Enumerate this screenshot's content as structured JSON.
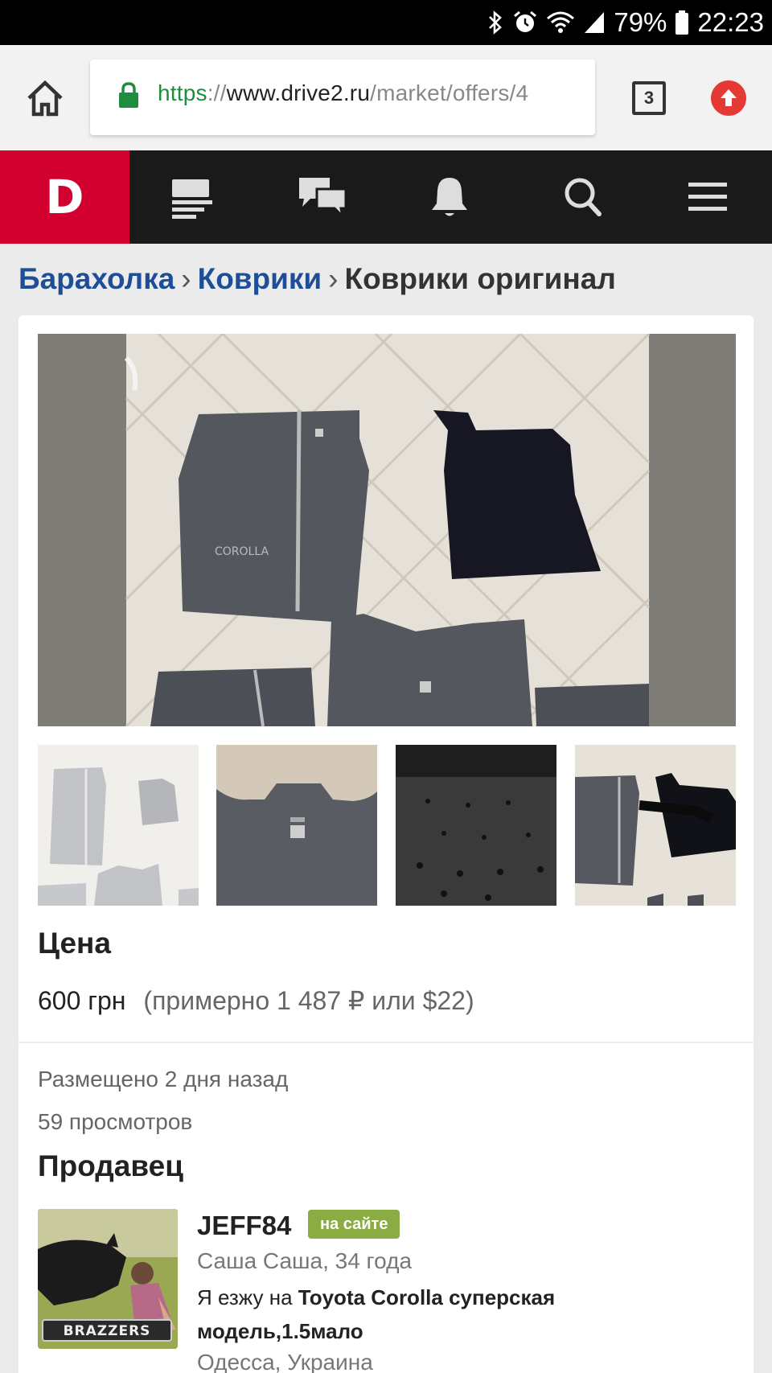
{
  "status_bar": {
    "battery": "79%",
    "time": "22:23",
    "icons": [
      "bluetooth-icon",
      "alarm-icon",
      "wifi-icon",
      "signal-icon",
      "battery-icon"
    ]
  },
  "browser": {
    "url_scheme": "https",
    "url_sep": "://",
    "url_host": "www.drive2.ru",
    "url_path": "/market/offers/4",
    "tabs_count": "3"
  },
  "site_nav": {
    "logo": "D",
    "items": [
      "feed-icon",
      "messages-icon",
      "notifications-icon",
      "search-icon",
      "menu-icon"
    ]
  },
  "breadcrumb": {
    "items": [
      "Барахолка",
      "Коврики"
    ],
    "separator": "›",
    "current": "Коврики оригинал"
  },
  "listing": {
    "price_title": "Цена",
    "price": "600 грн",
    "price_approx": "(примерно 1 487 ₽ или $22)",
    "posted": "Размещено 2 дня назад",
    "views": "59 просмотров"
  },
  "seller": {
    "title": "Продавец",
    "name": "JEFF84",
    "badge": "на сайте",
    "info": "Саша Саша, 34 года",
    "drive_prefix": "Я езжу на ",
    "drive_car": "Toyota Corolla суперская модель,1.5мало",
    "city": "Одесса, Украина",
    "avatar_watermark": "BRAZZERS"
  },
  "colors": {
    "brand_red": "#d2002e",
    "link_blue": "#1f4e99",
    "online_green": "#8aac42",
    "url_green": "#1e8e3e"
  }
}
